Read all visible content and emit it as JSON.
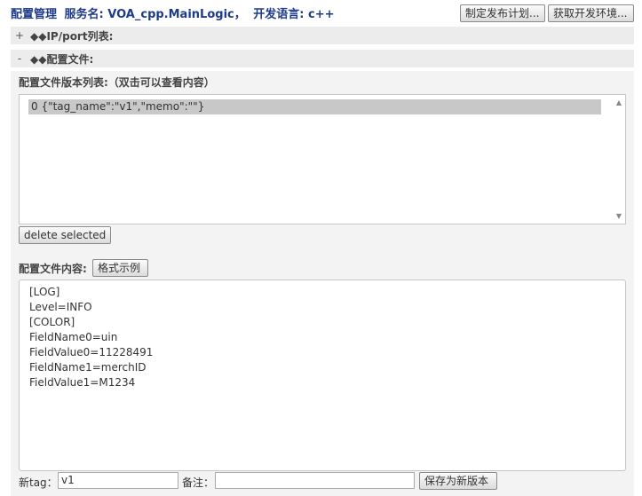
{
  "header": {
    "title": "配置管理",
    "service_label": "服务名: VOA_cpp.MainLogic，",
    "lang_label": "开发语言: c++",
    "btn_plan": "制定发布计划...",
    "btn_env": "获取开发环境..."
  },
  "sections": {
    "ip_port": {
      "toggle": "+",
      "label": "◆◆IP/port列表:"
    },
    "config_file": {
      "toggle": "-",
      "label": "◆◆配置文件:"
    }
  },
  "versions": {
    "label": "配置文件版本列表:（双击可以查看内容）",
    "items": [
      "0 {\"tag_name\":\"v1\",\"memo\":\"\"}"
    ],
    "delete_label": "delete selected"
  },
  "content": {
    "label": "配置文件内容:",
    "example_button": "格式示例",
    "lines": [
      "[LOG]",
      "Level=INFO",
      "[COLOR]",
      "FieldName0=uin",
      "FieldValue0=11228491",
      "FieldName1=merchID",
      "FieldValue1=M1234"
    ]
  },
  "save": {
    "tag_label": "新tag：",
    "tag_value": "v1",
    "memo_label": "备注：",
    "memo_value": "",
    "save_button": "保存为新版本"
  }
}
